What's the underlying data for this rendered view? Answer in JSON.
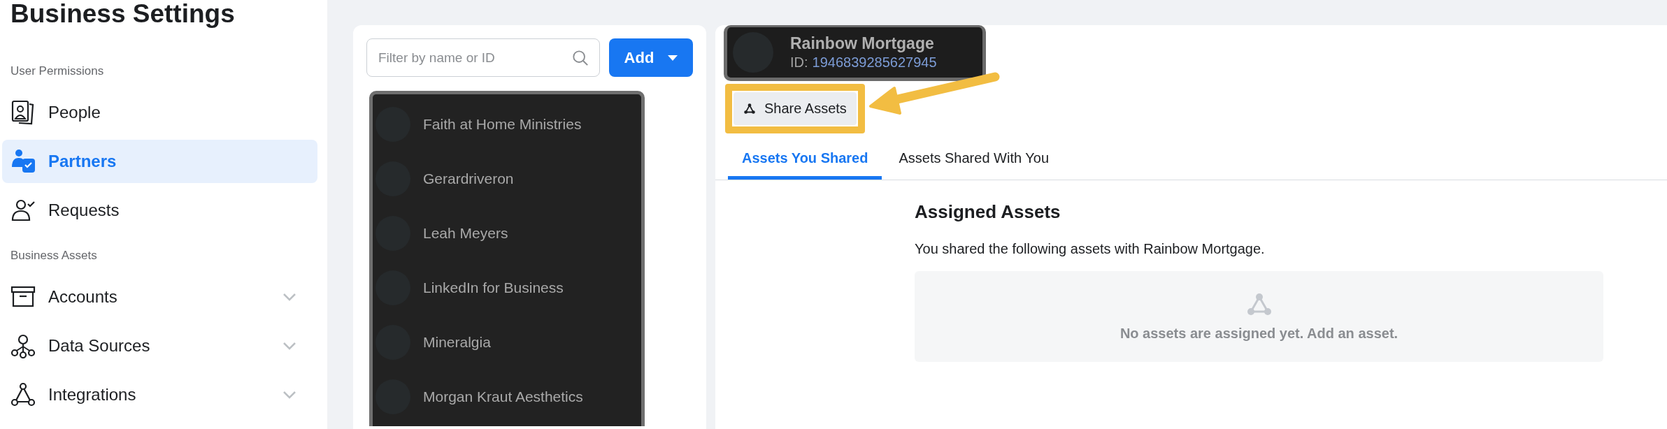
{
  "sidebar": {
    "title": "Business Settings",
    "sections": [
      {
        "heading": "User Permissions",
        "items": [
          {
            "label": "People",
            "selected": false,
            "expandable": false
          },
          {
            "label": "Partners",
            "selected": true,
            "expandable": false
          },
          {
            "label": "Requests",
            "selected": false,
            "expandable": false
          }
        ]
      },
      {
        "heading": "Business Assets",
        "items": [
          {
            "label": "Accounts",
            "selected": false,
            "expandable": true
          },
          {
            "label": "Data Sources",
            "selected": false,
            "expandable": true
          },
          {
            "label": "Integrations",
            "selected": false,
            "expandable": true
          }
        ]
      }
    ]
  },
  "partner_list": {
    "search": {
      "placeholder": "Filter by name or ID"
    },
    "add_button": "Add",
    "partners": [
      {
        "name": "Faith at Home Ministries"
      },
      {
        "name": "Gerardriveron"
      },
      {
        "name": "Leah Meyers"
      },
      {
        "name": "LinkedIn for Business"
      },
      {
        "name": "Mineralgia"
      },
      {
        "name": "Morgan Kraut Aesthetics"
      }
    ]
  },
  "partner_detail": {
    "name": "Rainbow Mortgage",
    "id_label": "ID:",
    "id": "1946839285627945",
    "share_button": "Share Assets",
    "tabs": [
      {
        "label": "Assets You Shared",
        "selected": true
      },
      {
        "label": "Assets Shared With You",
        "selected": false
      }
    ],
    "section_title": "Assigned Assets",
    "description": "You shared the following assets with Rainbow Mortgage.",
    "empty_message": "No assets are assigned yet. Add an asset."
  }
}
